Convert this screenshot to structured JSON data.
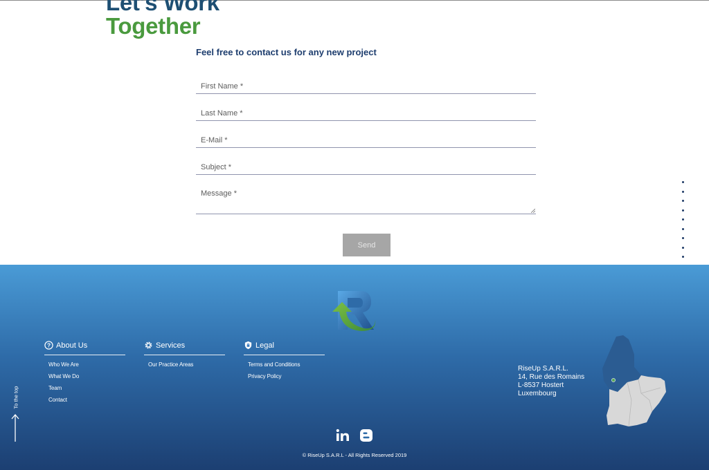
{
  "heading": {
    "line1": "Let's Work",
    "line2": "Together"
  },
  "intro": "Feel free to contact us for any new project",
  "form": {
    "first_name_placeholder": "First Name *",
    "last_name_placeholder": "Last Name *",
    "email_placeholder": "E-Mail *",
    "subject_placeholder": "Subject *",
    "message_placeholder": "Message *",
    "send_label": "Send"
  },
  "footer": {
    "columns": [
      {
        "title": "About Us",
        "icon": "question-circle-icon",
        "items": [
          "Who We Are",
          "What We Do",
          "Team",
          "Contact"
        ]
      },
      {
        "title": "Services",
        "icon": "gear-icon",
        "items": [
          "Our Practice Areas"
        ]
      },
      {
        "title": "Legal",
        "icon": "lock-shield-icon",
        "items": [
          "Terms and Conditions",
          "Privacy Policy"
        ]
      }
    ],
    "address": [
      "RiseUp S.A.R.L.",
      "14, Rue des Romains",
      "L-8537 Hostert",
      "Luxembourg"
    ],
    "to_top": "To the top",
    "social_icons": [
      "linkedin-icon",
      "blogger-icon"
    ],
    "copyright": "© RiseUp S.A.R.L - All Rights Reserved 2019"
  },
  "colors": {
    "heading_dark": "#1e4f73",
    "heading_green": "#4a9a3e",
    "footer_top": "#4a9bd6",
    "footer_bottom": "#1c3f72",
    "send_button": "#a6a6a6"
  }
}
